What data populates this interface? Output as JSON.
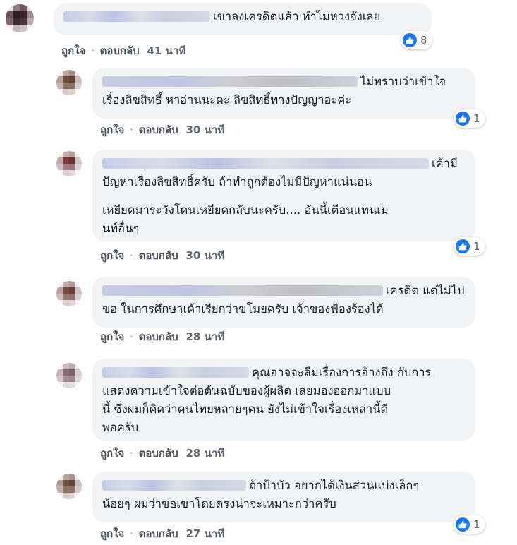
{
  "actions": {
    "like": "ถูกใจ",
    "reply": "ตอบกลับ",
    "separator": "·"
  },
  "accent_color": "#1877f2",
  "like_icon": "thumbs-up-icon",
  "comments": [
    {
      "lines": [
        "เขาลงเครดิตแล้ว ทำไมหวงจังเลย"
      ],
      "time": "41 นาที",
      "reactions": "8"
    },
    {
      "lines": [
        "ไม่ทราบว่าเข้าใจ",
        "เรื่องลิขสิทธิ์ หาอ่านนะคะ ลิขสิทธิ์ทางปัญญาอะค่ะ"
      ],
      "time": "30 นาที",
      "reactions": "1"
    },
    {
      "lines": [
        "เค้ามี",
        "ปัญหาเรื่องลิขสิทธิ์ครับ ถ้าทำถูกต้องไม่มีปัญหาแน่นอน"
      ],
      "lines2": [
        "เหยียดมาระวังโดนเหยียดกลับนะครับ.... อันนี้เตือนแทนเม",
        "นท์อื่นๆ"
      ],
      "time": "30 นาที",
      "reactions": "1"
    },
    {
      "lines": [
        "เครดิต แต่ไม่ไป",
        "ขอ ในการศึกษาเค้าเรียกว่าขโมยครับ เจ้าของฟ้องร้องได้"
      ],
      "time": "28 นาที",
      "reactions": ""
    },
    {
      "lines": [
        "คุณอาจจะลืมเรื่องการอ้างถึง กับการ",
        "แสดงความเข้าใจต่อต้นฉบับของผู้ผลิต เลยมองออกมาแบบ",
        "นี้ ซึ่งผมก็คิดว่าคนไทยหลายๆคน ยังไม่เข้าใจเรื่องเหล่านี้ดี",
        "พอครับ"
      ],
      "time": "28 นาที",
      "reactions": ""
    },
    {
      "lines": [
        "ถ้าป้าบัว อยากได้เงินส่วนแบ่งเล็กๆ",
        "น้อยๆ ผมว่าขอเขาโดยตรงน่าจะเหมาะกว่าครับ"
      ],
      "time": "27 นาที",
      "reactions": "1"
    }
  ]
}
